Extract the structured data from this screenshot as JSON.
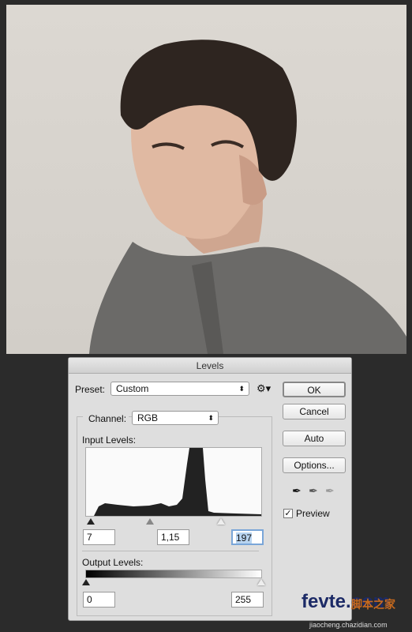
{
  "dialog": {
    "title": "Levels",
    "preset_label": "Preset:",
    "preset_value": "Custom",
    "channel_label": "Channel:",
    "channel_value": "RGB",
    "input_levels_label": "Input Levels:",
    "input_black": "7",
    "input_gamma": "1,15",
    "input_white": "197",
    "output_levels_label": "Output Levels:",
    "output_black": "0",
    "output_white": "255",
    "buttons": {
      "ok": "OK",
      "cancel": "Cancel",
      "auto": "Auto",
      "options": "Options..."
    },
    "preview_label": "Preview",
    "preview_checked": true,
    "icons": [
      "gear-icon",
      "black-eyedropper-icon",
      "gray-eyedropper-icon",
      "white-eyedropper-icon"
    ]
  },
  "watermark": {
    "line1": "fevte.com",
    "line2": "脚本之家",
    "line3": "jiaocheng.chazidian.com"
  },
  "colors": {
    "background": "#2b2b2b",
    "dialog": "#dedede",
    "selection": "#b8d4f0"
  }
}
